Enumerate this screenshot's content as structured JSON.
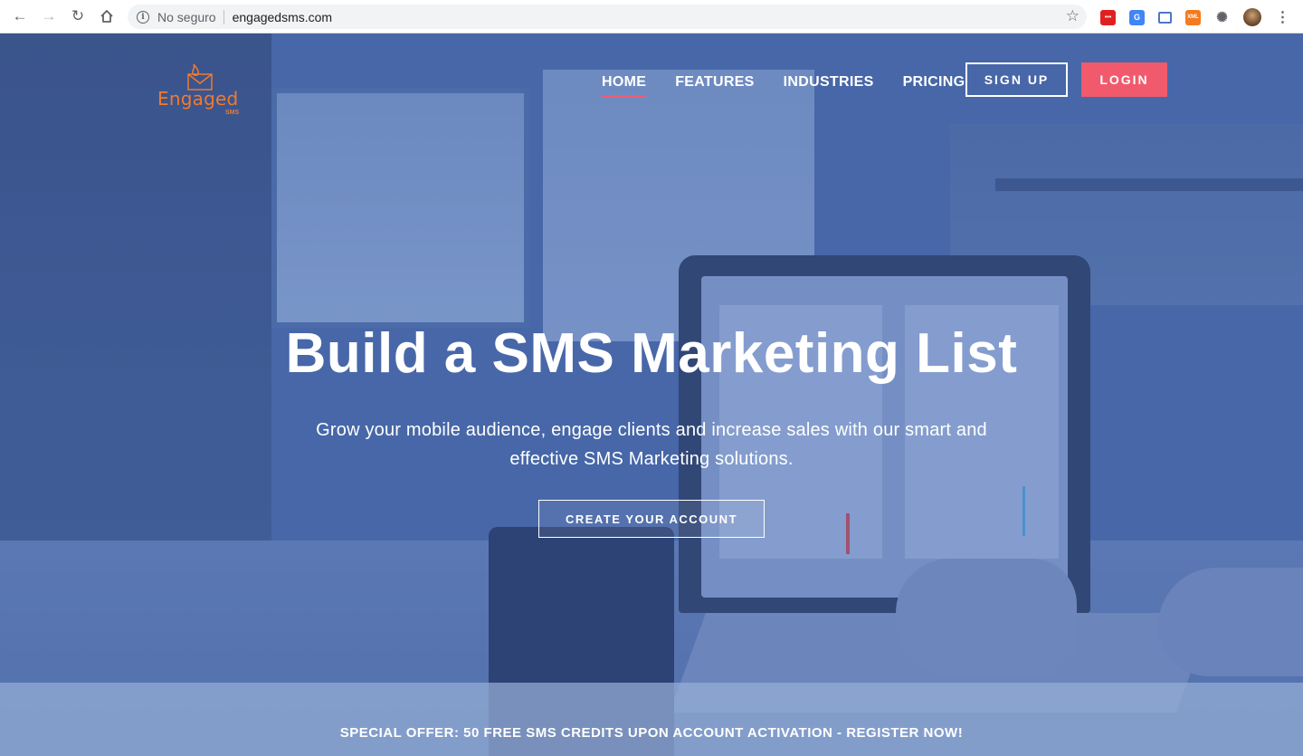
{
  "browser": {
    "security_label": "No seguro",
    "url": "engagedsms.com",
    "extensions": [
      "red-ext-icon",
      "google-translate-icon",
      "print-icon",
      "xml-icon",
      "extensions-puzzle-icon",
      "profile-avatar",
      "menu-kebab-icon"
    ],
    "ext_labels": {
      "red": "•••",
      "gtrans": "G",
      "xml": "XML"
    }
  },
  "site": {
    "logo": {
      "name": "Engaged",
      "sub": "SMS",
      "color": "#f07a2d"
    },
    "nav": [
      {
        "label": "HOME",
        "active": true
      },
      {
        "label": "FEATURES",
        "active": false
      },
      {
        "label": "INDUSTRIES",
        "active": false
      },
      {
        "label": "PRICING",
        "active": false
      }
    ],
    "signup_label": "SIGN UP",
    "login_label": "LOGIN",
    "accent_color": "#f15a6c"
  },
  "hero": {
    "title": "Build a SMS Marketing List",
    "subtitle": "Grow your mobile audience, engage clients and increase sales with our smart and effective SMS Marketing solutions.",
    "cta_label": "CREATE YOUR ACCOUNT"
  },
  "offer": {
    "text": "SPECIAL OFFER: 50 FREE SMS CREDITS UPON ACCOUNT ACTIVATION - REGISTER NOW!"
  }
}
